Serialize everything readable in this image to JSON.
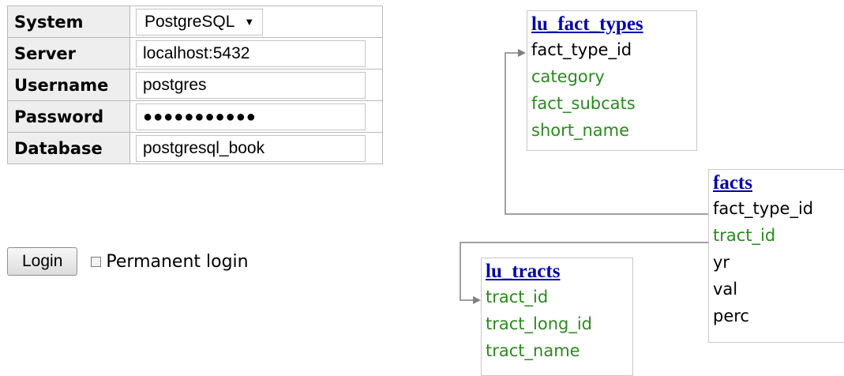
{
  "login": {
    "system_label": "System",
    "system_value": "PostgreSQL",
    "server_label": "Server",
    "server_value": "localhost:5432",
    "username_label": "Username",
    "username_value": "postgres",
    "password_label": "Password",
    "password_mask": "●●●●●●●●●●●",
    "database_label": "Database",
    "database_value": "postgresql_book",
    "login_button": "Login",
    "permanent_login_label": "Permanent login",
    "permanent_login_checked": false
  },
  "schema": {
    "lu_fact_types": {
      "name": "lu_fact_types",
      "columns": [
        "fact_type_id",
        "category",
        "fact_subcats",
        "short_name"
      ]
    },
    "facts": {
      "name": "facts",
      "columns": [
        "fact_type_id",
        "tract_id",
        "yr",
        "val",
        "perc"
      ]
    },
    "lu_tracts": {
      "name": "lu_tracts",
      "columns": [
        "tract_id",
        "tract_long_id",
        "tract_name"
      ]
    },
    "colors": {
      "link": "#0000aa",
      "fk_column": "#2a8a1e",
      "column": "#000000",
      "line": "#808080"
    }
  }
}
